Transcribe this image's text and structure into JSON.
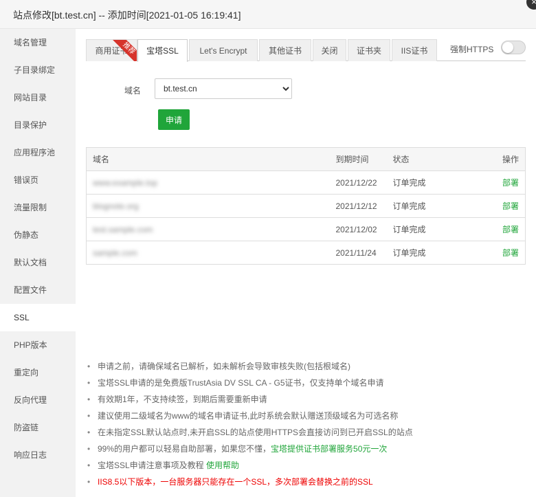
{
  "window": {
    "title": "站点修改[bt.test.cn] -- 添加时间[2021-01-05 16:19:41]",
    "close_glyph": "×"
  },
  "sidebar": {
    "items": [
      {
        "label": "域名管理"
      },
      {
        "label": "子目录绑定"
      },
      {
        "label": "网站目录"
      },
      {
        "label": "目录保护"
      },
      {
        "label": "应用程序池"
      },
      {
        "label": "错误页"
      },
      {
        "label": "流量限制"
      },
      {
        "label": "伪静态"
      },
      {
        "label": "默认文档"
      },
      {
        "label": "配置文件"
      },
      {
        "label": "SSL"
      },
      {
        "label": "PHP版本"
      },
      {
        "label": "重定向"
      },
      {
        "label": "反向代理"
      },
      {
        "label": "防盗链"
      },
      {
        "label": "响应日志"
      }
    ],
    "active": "SSL"
  },
  "tabs": {
    "items": [
      {
        "label": "商用证书"
      },
      {
        "label": "宝塔SSL"
      },
      {
        "label": "Let's Encrypt"
      },
      {
        "label": "其他证书"
      },
      {
        "label": "关闭"
      },
      {
        "label": "证书夹"
      },
      {
        "label": "IIS证书"
      }
    ],
    "active": "宝塔SSL",
    "ribbon": "推荐"
  },
  "force_https": {
    "label": "强制HTTPS",
    "enabled": false
  },
  "form": {
    "domain_label": "域名",
    "domain_value": "bt.test.cn",
    "apply_label": "申请"
  },
  "table": {
    "headers": {
      "domain": "域名",
      "expire": "到期时间",
      "status": "状态",
      "action": "操作"
    },
    "rows": [
      {
        "domain": "www.example.top",
        "expire": "2021/12/22",
        "status": "订单完成",
        "action": "部署"
      },
      {
        "domain": "blognote.org",
        "expire": "2021/12/12",
        "status": "订单完成",
        "action": "部署"
      },
      {
        "domain": "test.sample.com",
        "expire": "2021/12/02",
        "status": "订单完成",
        "action": "部署"
      },
      {
        "domain": "sample.com",
        "expire": "2021/11/24",
        "status": "订单完成",
        "action": "部署"
      }
    ]
  },
  "notes": {
    "n1": "申请之前，请确保域名已解析，如未解析会导致审核失败(包括根域名)",
    "n2": "宝塔SSL申请的是免费版TrustAsia DV SSL CA - G5证书，仅支持单个域名申请",
    "n3": "有效期1年，不支持续签，到期后需要重新申请",
    "n4": "建议使用二级域名为www的域名申请证书,此时系统会默认赠送顶级域名为可选名称",
    "n5": "在未指定SSL默认站点时,未开启SSL的站点使用HTTPS会直接访问到已开启SSL的站点",
    "n6_text": "99%的用户都可以轻易自助部署，如果您不懂，",
    "n6_link": "宝塔提供证书部署服务50元一次",
    "n7_text": "宝塔SSL申请注意事项及教程 ",
    "n7_link": "使用帮助",
    "n8": "IIS8.5以下版本，一台服务器只能存在一个SSL，多次部署会替换之前的SSL"
  },
  "colors": {
    "accent": "#20a53a",
    "warning": "#e00000",
    "ribbon": "#d6342c"
  }
}
